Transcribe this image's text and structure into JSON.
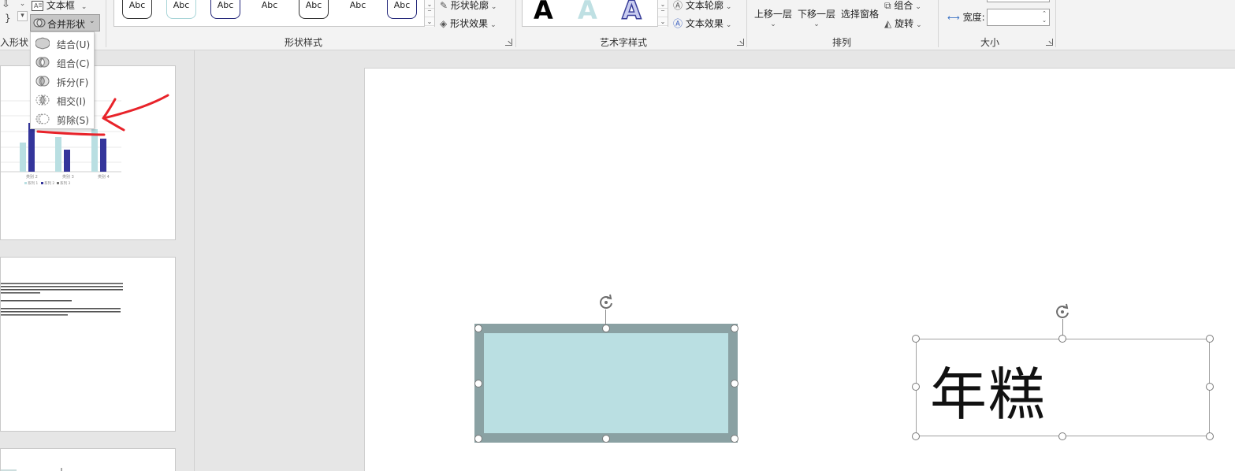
{
  "ribbon": {
    "insert_shapes_label_partial": "入形状",
    "textbox_label": "文本框",
    "merge_shapes_label": "合并形状",
    "shape_styles_label": "形状样式",
    "shape_outline_label": "形状轮廓",
    "shape_effects_label": "形状效果",
    "gallery_sample": "Abc",
    "wordart_styles_label": "艺术字样式",
    "wordart_sample": "A",
    "text_outline_label": "文本轮廓",
    "text_effects_label": "文本效果",
    "bring_forward_label": "上移一层",
    "send_backward_label": "下移一层",
    "selection_pane_label": "选择窗格",
    "group_label": "组合",
    "rotate_label": "旋转",
    "arrange_label": "排列",
    "width_label": "宽度:",
    "width_value": "",
    "size_label": "大小"
  },
  "merge_menu": {
    "items": [
      {
        "label": "结合(U)",
        "icon": "union-icon"
      },
      {
        "label": "组合(C)",
        "icon": "combine-icon"
      },
      {
        "label": "拆分(F)",
        "icon": "fragment-icon"
      },
      {
        "label": "相交(I)",
        "icon": "intersect-icon"
      },
      {
        "label": "剪除(S)",
        "icon": "subtract-icon"
      }
    ]
  },
  "thumbnail_chart": {
    "tick_labels": [
      "类别 2",
      "类别 3",
      "类别 4"
    ],
    "legend": [
      "系列 1",
      "系列 2",
      "系列 3"
    ]
  },
  "slide": {
    "text_box_content": "年糕",
    "rect_fill": "#badfe2",
    "rect_border": "#8aa1a3"
  },
  "colors": {
    "annotation_red": "#e8232a",
    "chart_light": "#b9dfe2",
    "chart_dark": "#34359b"
  }
}
